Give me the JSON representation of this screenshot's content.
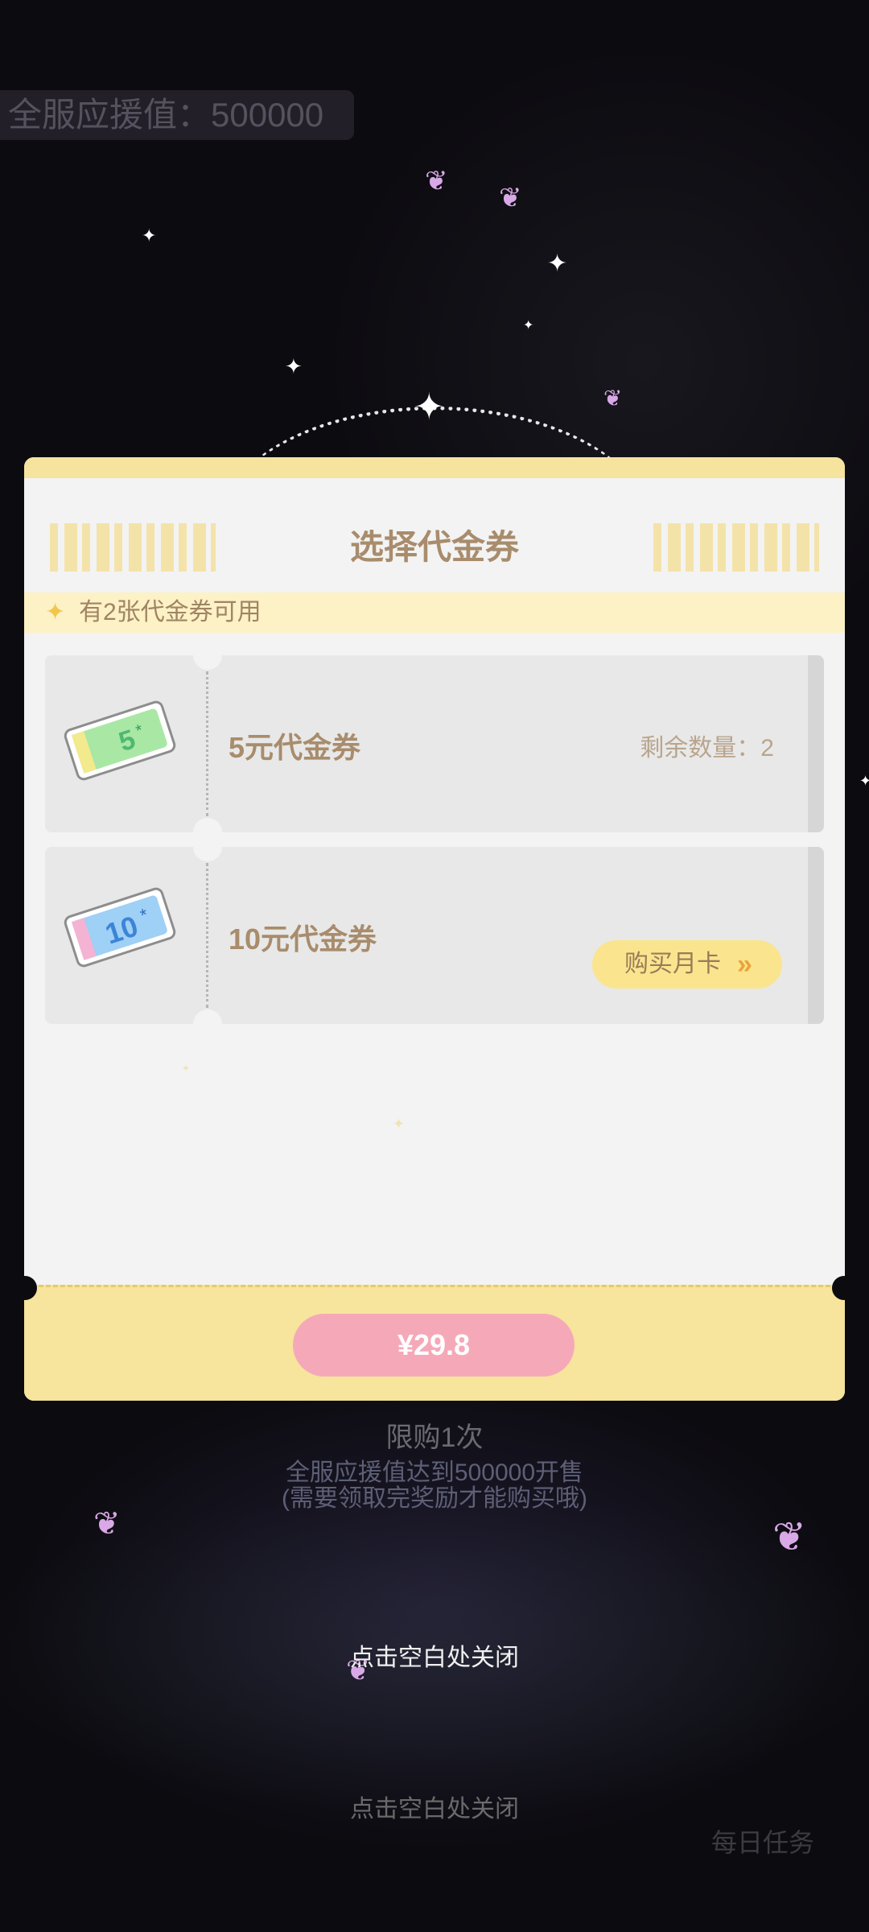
{
  "background": {
    "banner_text": "全服应援值：500000",
    "limit_text": "限购1次",
    "sale_condition_line1": "全服应援值达到500000开售",
    "sale_condition_line2": "(需要领取完奖励才能购买哦)",
    "close_hint_main": "点击空白处关闭",
    "close_hint_bottom": "点击空白处关闭",
    "daily_task": "每日任务"
  },
  "modal": {
    "title": "选择代金券",
    "notice": "有2张代金券可用",
    "coupons": [
      {
        "name": "5元代金券",
        "remaining_label": "剩余数量：2",
        "icon": "sale-5-voucher-icon",
        "value": "5",
        "icon_color": "#9ee39a"
      },
      {
        "name": "10元代金券",
        "action_label": "购买月卡",
        "icon": "sale-10-voucher-icon",
        "value": "10",
        "icon_color": "#8fc8f3"
      }
    ],
    "price": "¥29.8"
  },
  "colors": {
    "accent_yellow": "#f7e49d",
    "title_brown": "#a88c6c",
    "pay_pink": "#f5a9b8"
  }
}
